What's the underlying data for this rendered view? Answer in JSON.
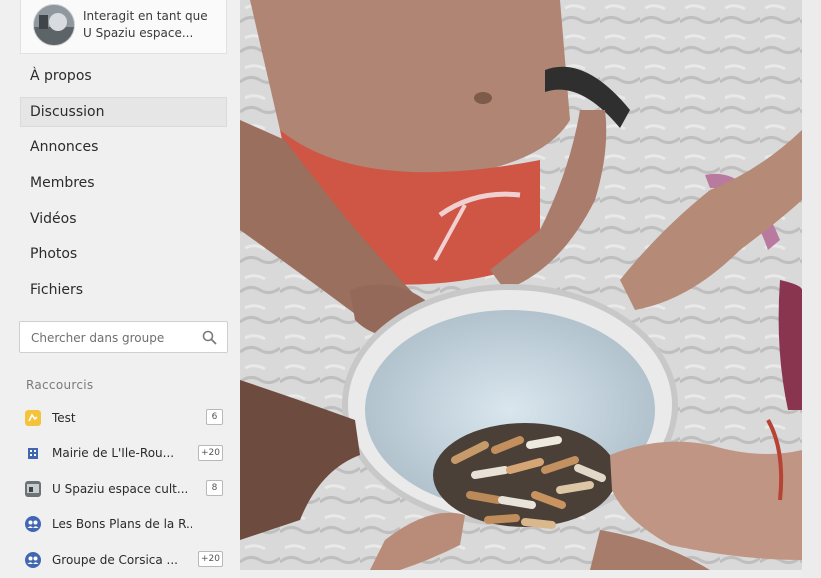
{
  "acting_as": {
    "line1": "Interagit en tant que",
    "line2": "U Spaziu espace..."
  },
  "nav": {
    "items": [
      {
        "label": "À propos",
        "active": false
      },
      {
        "label": "Discussion",
        "active": true
      },
      {
        "label": "Annonces",
        "active": false
      },
      {
        "label": "Membres",
        "active": false
      },
      {
        "label": "Vidéos",
        "active": false
      },
      {
        "label": "Photos",
        "active": false
      },
      {
        "label": "Fichiers",
        "active": false
      }
    ]
  },
  "search": {
    "placeholder": "Chercher dans groupe"
  },
  "shortcuts": {
    "heading": "Raccourcis",
    "items": [
      {
        "name": "Test",
        "badge": "6",
        "icon": "yellow-group-icon"
      },
      {
        "name": "Mairie de L'Ile-Rou...",
        "badge": "+20",
        "icon": "building-icon"
      },
      {
        "name": "U Spaziu espace cult...",
        "badge": "8",
        "icon": "page-photo-icon"
      },
      {
        "name": "Les Bons Plans de la R...",
        "badge": "",
        "icon": "blue-group-icon"
      },
      {
        "name": "Groupe de Corsica ...",
        "badge": "+20",
        "icon": "blue-group-icon"
      }
    ]
  },
  "post_image": {
    "description_icon": "beach-photo"
  },
  "colors": {
    "accent_blue": "#4267b2",
    "yellow": "#f5c33b",
    "sidebar_bg": "#f0f0f0"
  }
}
